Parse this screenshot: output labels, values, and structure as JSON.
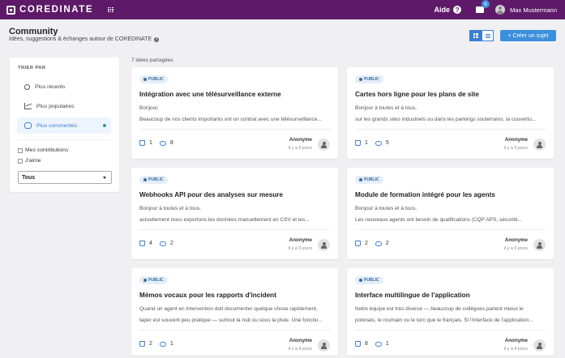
{
  "app": {
    "name": "COREDINATE"
  },
  "topbar": {
    "help_label": "Aide",
    "notification_count": "6",
    "user_name": "Max Mustermann"
  },
  "header": {
    "title": "Community",
    "subtitle": "Idées, suggestions & échanges autour de COREDINATE",
    "create_button": "+ Créer un sujet"
  },
  "sidebar": {
    "sort_title": "TRIER PAR",
    "sort_options": [
      {
        "label": "Plus récents",
        "icon": "clock-icon",
        "active": false
      },
      {
        "label": "Plus populaires",
        "icon": "chart-icon",
        "active": false
      },
      {
        "label": "Plus commentés",
        "icon": "chat-icon",
        "active": true
      }
    ],
    "filters": [
      {
        "label": "Mes contributions",
        "checked": false
      },
      {
        "label": "J'aime",
        "checked": false
      }
    ],
    "select_value": "Tous"
  },
  "list": {
    "count_label": "7 idées partagées",
    "cards": [
      {
        "badge": "PUBLIC",
        "title": "Intégration avec une télésurveillance externe",
        "line1": "Bonjour,",
        "line2": "Beaucoup de nos clients importants ont un contrat avec une télésurveillance...",
        "likes": "1",
        "comments": "8",
        "author": "Anonyme",
        "ago": "il y a 5 jours"
      },
      {
        "badge": "PUBLIC",
        "title": "Cartes hors ligne pour les plans de site",
        "line1": "Bonjour à toutes et à tous,",
        "line2": "sur les grands sites industriels ou dans les parkings souterrains, la couvertu...",
        "likes": "1",
        "comments": "5",
        "author": "Anonyme",
        "ago": "il y a 5 jours"
      },
      {
        "badge": "PUBLIC",
        "title": "Webhooks API pour des analyses sur mesure",
        "line1": "Bonjour à toutes et à tous,",
        "line2": "actuellement nous exportons les données manuellement en CSV et les...",
        "likes": "4",
        "comments": "2",
        "author": "Anonyme",
        "ago": "il y a 5 jours"
      },
      {
        "badge": "PUBLIC",
        "title": "Module de formation intégré pour les agents",
        "line1": "Bonjour à toutes et à tous,",
        "line2": "Les nouveaux agents ont besoin de qualifications (CQP APS, sécurité...",
        "likes": "2",
        "comments": "2",
        "author": "Anonyme",
        "ago": "il y a 5 jours"
      },
      {
        "badge": "PUBLIC",
        "title": "Mémos vocaux pour les rapports d'incident",
        "line1": "Quand un agent en intervention doit documenter quelque chose rapidement,",
        "line2": "taper est souvent peu pratique — surtout la nuit ou sous la pluie. Une fonctio...",
        "likes": "2",
        "comments": "1",
        "author": "Anonyme",
        "ago": "il y a 4 jours"
      },
      {
        "badge": "PUBLIC",
        "title": "Interface multilingue de l'application",
        "line1": "Notre équipe est très diverse — beaucoup de collègues parlent mieux le",
        "line2": "polonais, le roumain ou le turc que le français. Si l'interface de l'application...",
        "likes": "8",
        "comments": "1",
        "author": "Anonyme",
        "ago": "il y a 4 jours"
      }
    ]
  }
}
